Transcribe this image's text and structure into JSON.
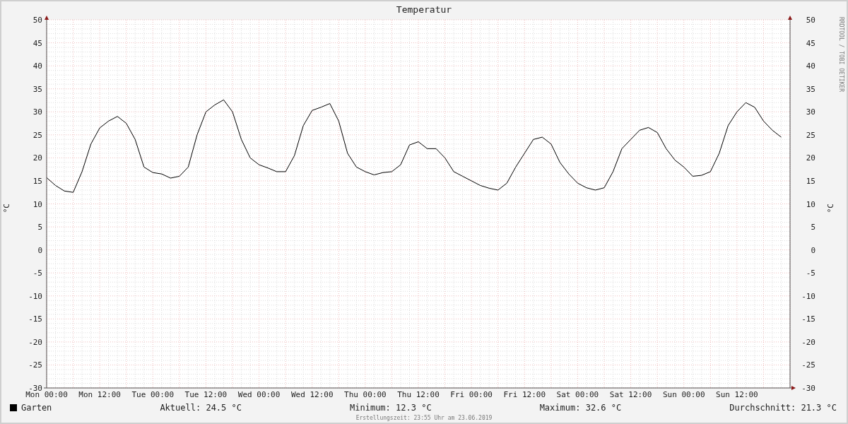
{
  "title": "Temperatur",
  "left_axis_label": "°C",
  "right_axis": {
    "label": "°C",
    "ticks": [
      "50",
      "45",
      "40",
      "35",
      "30",
      "25",
      "20",
      "15",
      "10",
      "5",
      "0",
      "-5",
      "-10",
      "-15",
      "-20",
      "-25",
      "-30"
    ]
  },
  "credit": "RRDTOOL / TOBI OETIKER",
  "chart_data": {
    "type": "line",
    "grid": true,
    "ylim": [
      -30,
      50
    ],
    "yticks": [
      50,
      45,
      40,
      35,
      30,
      25,
      20,
      15,
      10,
      5,
      0,
      -5,
      -10,
      -15,
      -20,
      -25,
      -30
    ],
    "categories": [
      "Mon 00:00",
      null,
      null,
      null,
      null,
      null,
      "Mon 12:00",
      null,
      null,
      null,
      null,
      null,
      "Tue 00:00",
      null,
      null,
      null,
      null,
      null,
      "Tue 12:00",
      null,
      null,
      null,
      null,
      null,
      "Wed 00:00",
      null,
      null,
      null,
      null,
      null,
      "Wed 12:00",
      null,
      null,
      null,
      null,
      null,
      "Thu 00:00",
      null,
      null,
      null,
      null,
      null,
      "Thu 12:00",
      null,
      null,
      null,
      null,
      null,
      "Fri 00:00",
      null,
      null,
      null,
      null,
      null,
      "Fri 12:00",
      null,
      null,
      null,
      null,
      null,
      "Sat 00:00",
      null,
      null,
      null,
      null,
      null,
      "Sat 12:00",
      null,
      null,
      null,
      null,
      null,
      "Sun 00:00",
      null,
      null,
      null,
      null,
      null,
      "Sun 12:00",
      null,
      null,
      null,
      null,
      null
    ],
    "series": [
      {
        "name": "Garten",
        "color": "#000000",
        "values": [
          15.7,
          14,
          12.8,
          12.5,
          17,
          23,
          26.5,
          28,
          29,
          27.5,
          24,
          18,
          16.8,
          16.5,
          15.6,
          16,
          18,
          25,
          30,
          31.5,
          32.6,
          30,
          24,
          20,
          18.5,
          17.8,
          17,
          17,
          20.5,
          27,
          30.3,
          31,
          31.8,
          28,
          21,
          18,
          17,
          16.3,
          16.8,
          17,
          18.5,
          22.8,
          23.5,
          22,
          22,
          20,
          17,
          16,
          15,
          14,
          13.4,
          13,
          14.5,
          18,
          21,
          24,
          24.5,
          23,
          19,
          16.5,
          14.5,
          13.5,
          13,
          13.5,
          17,
          22,
          24,
          26,
          26.6,
          25.5,
          22,
          19.5,
          18,
          16,
          16.2,
          17,
          21,
          27,
          30,
          32,
          31,
          28,
          26,
          24.5
        ]
      }
    ]
  },
  "stats": [
    "Aktuell: 24.5 °C",
    "Minimum: 12.3 °C",
    "Maximum: 32.6 °C",
    "Durchschnitt: 21.3 °C"
  ],
  "footer": "Erstellungszeit: 23:55 Uhr am 23.06.2019"
}
